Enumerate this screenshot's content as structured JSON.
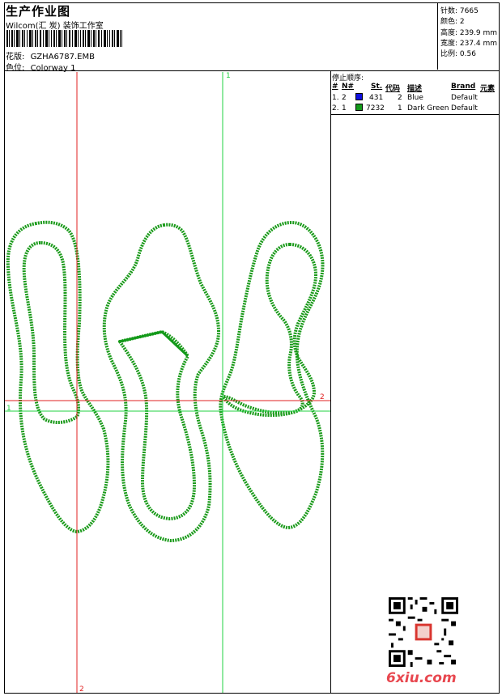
{
  "header": {
    "title": "生产作业图",
    "subtitle": "Wilcom(汇 炭) 装饰工作室",
    "design_label": "花版:",
    "design_value": "GZHA6787.EMB",
    "colorway_label": "色位:",
    "colorway_value": "Colorway 1"
  },
  "stats": {
    "stitches": "针数: 7665",
    "colors": "颜色: 2",
    "height": "高度: 239.9 mm",
    "width": "宽度: 237.4 mm",
    "scale": "比例: 0.56"
  },
  "stop_sequence": {
    "heading": "停止顺序:",
    "columns": [
      "#",
      "N#",
      "St.",
      "代码",
      "描述",
      "Brand",
      "元素"
    ],
    "rows": [
      {
        "index": "1.",
        "needle": "2",
        "stitches": "431",
        "code": "2",
        "desc": "Blue",
        "brand": "Default",
        "color": "#1010e0"
      },
      {
        "index": "2.",
        "needle": "1",
        "stitches": "7232",
        "code": "1",
        "desc": "Dark Green",
        "brand": "Default",
        "color": "#139a1a"
      }
    ]
  },
  "guides": {
    "red_v_label": "2",
    "red_h_label": "2",
    "green_v_label": "1",
    "green_h_label": "1"
  },
  "watermark": {
    "site": "6xiu.com"
  },
  "colors": {
    "stitch_green": "#1a9a1a",
    "guide_red": "#e02020",
    "guide_green": "#20d040"
  }
}
